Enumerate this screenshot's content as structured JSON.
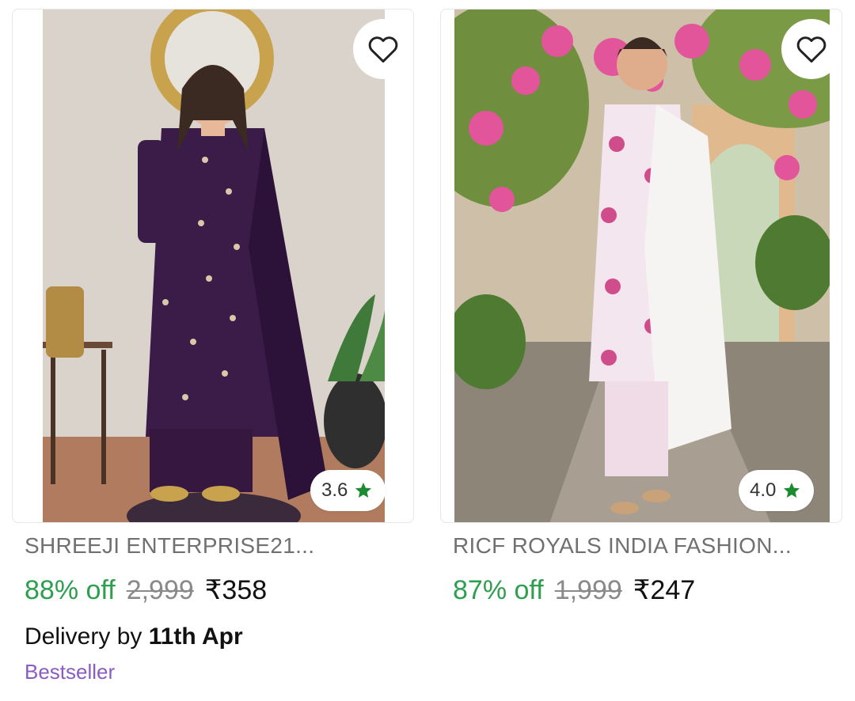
{
  "products": [
    {
      "brand": "SHREEJI ENTERPRISE21...",
      "discount": "88% off",
      "mrp": "2,999",
      "price": "₹358",
      "rating": "3.6",
      "delivery_prefix": "Delivery by ",
      "delivery_date": "11th Apr",
      "tag": "Bestseller",
      "image_icon": "woman-purple-kurta-photo"
    },
    {
      "brand": "RICF ROYALS INDIA FASHION...",
      "discount": "87% off",
      "mrp": "1,999",
      "price": "₹247",
      "rating": "4.0",
      "image_icon": "woman-pink-floral-kurta-photo"
    }
  ],
  "colors": {
    "discount": "#2e9e4f",
    "star": "#1a8b2e",
    "tag": "#8a5cc2",
    "brand": "#707070"
  },
  "icons": {
    "wishlist": "heart-outline-icon",
    "rating": "star-icon"
  }
}
